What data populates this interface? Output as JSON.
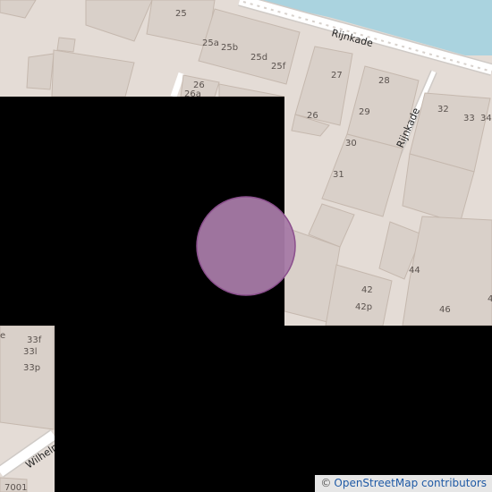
{
  "map": {
    "colors": {
      "land": "#e4dcd6",
      "water": "#aad3df",
      "building": "#d9d0c9",
      "building_stroke": "#c5b8ae",
      "road": "#ffffff",
      "road_casing": "#cfcac6",
      "mask": "#000000",
      "marker_fill": "#a67aa7",
      "marker_stroke": "#8b4f8d"
    },
    "marker": {
      "shape": "circle"
    },
    "streets": [
      {
        "name": "Rijnkade"
      },
      {
        "name": "Rijnkade"
      },
      {
        "name": "Wilhelmi"
      }
    ],
    "house_numbers": [
      "25",
      "25a",
      "25b",
      "25d",
      "25f",
      "26",
      "26a",
      "27",
      "26",
      "28",
      "29",
      "32",
      "33",
      "34",
      "30",
      "31",
      "44",
      "42",
      "42p",
      "46",
      "33f",
      "33l",
      "33p",
      "7001",
      "e",
      "4"
    ],
    "attribution": {
      "symbol": "©",
      "text": "OpenStreetMap contributors"
    }
  }
}
